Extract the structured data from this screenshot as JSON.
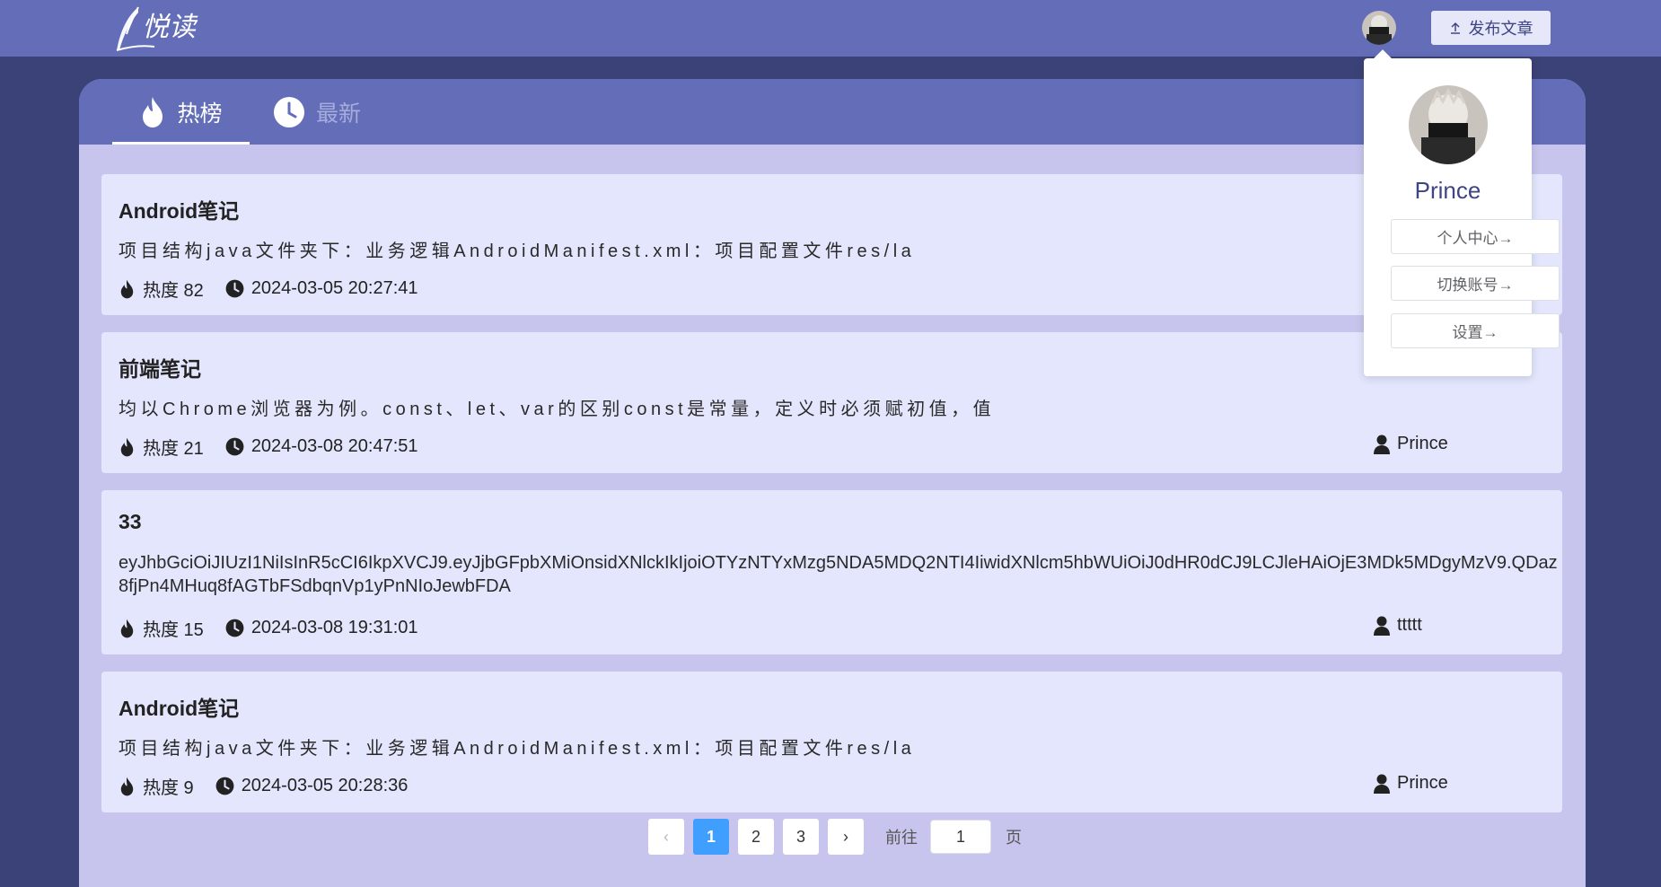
{
  "header": {
    "publish_label": "发布文章"
  },
  "tabs": [
    {
      "label": "热榜",
      "icon": "fire-icon"
    },
    {
      "label": "最新",
      "icon": "clock-icon"
    }
  ],
  "articles": [
    {
      "title": "Android笔记",
      "summary": "项目结构java文件夹下：业务逻辑AndroidManifest.xml：项目配置文件res/la",
      "heat": "热度 82",
      "date": "2024-03-05 20:27:41",
      "author": ""
    },
    {
      "title": "前端笔记",
      "summary": "均以Chrome浏览器为例。const、let、var的区别const是常量，定义时必须赋初值，值",
      "heat": "热度 21",
      "date": "2024-03-08 20:47:51",
      "author": "Prince"
    },
    {
      "title": "33",
      "summary": "eyJhbGciOiJIUzI1NiIsInR5cCI6IkpXVCJ9.eyJjbGFpbXMiOnsidXNlckIkIjoiOTYzNTYxMzg5NDA5MDQ2NTI4IiwidXNlcm5hbWUiOiJ0dHR0dCJ9LCJleHAiOjE3MDk5MDgyMzV9.QDaz8fjPn4MHuq8fAGTbFSdbqnVp1yPnNIoJewbFDA",
      "heat": "热度 15",
      "date": "2024-03-08 19:31:01",
      "author": "ttttt"
    },
    {
      "title": "Android笔记",
      "summary": "项目结构java文件夹下：业务逻辑AndroidManifest.xml：项目配置文件res/la",
      "heat": "热度 9",
      "date": "2024-03-05 20:28:36",
      "author": "Prince"
    }
  ],
  "pagination": {
    "prev": "‹",
    "pages": [
      "1",
      "2",
      "3"
    ],
    "current": "1",
    "next": "›",
    "goto_label": "前往",
    "goto_value": "1",
    "page_suffix": "页"
  },
  "user_menu": {
    "name": "Prince",
    "items": [
      "个人中心→",
      "切换账号→",
      "设置→"
    ]
  },
  "colors": {
    "header": "#636db8",
    "background": "#3b4277",
    "content": "#c7c5ed",
    "card": "#e3e6fc",
    "active_page": "#409eff"
  }
}
